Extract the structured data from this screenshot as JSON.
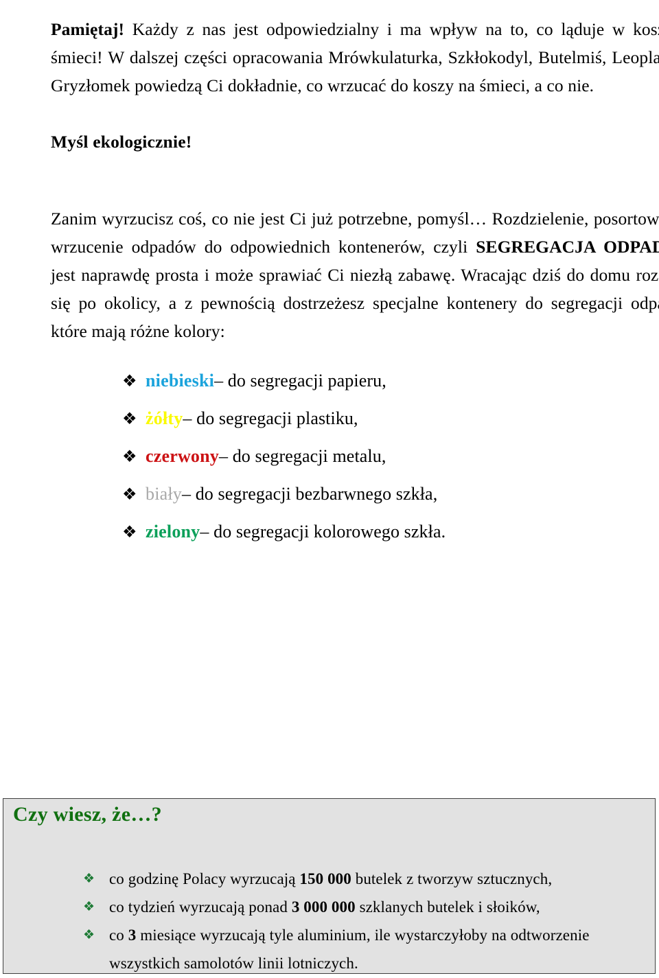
{
  "document": {
    "intro": {
      "bold_lead": "Pamiętaj!",
      "text": " Każdy z nas jest odpowiedzialny i ma wpływ na to, co ląduje w koszu na śmieci! W dalszej części opracowania Mrówkulaturka, Szkłokodyl, Butelmiś, Leoplastuś i Gryzłomek powiedzą Ci dokładnie, co wrzucać do koszy na śmieci, a co nie."
    },
    "subheading": "Myśl ekologicznie!",
    "body": {
      "part1": "Zanim wyrzucisz coś, co nie jest Ci już potrzebne, pomyśl… Rozdzielenie, posortowanie i wrzucenie odpadów do odpowiednich kontenerów, czyli ",
      "emphasis": "SEGREGACJA ODPADÓW,",
      "part2": " jest naprawdę prosta i może sprawiać Ci niezłą zabawę. Wracając dziś do domu rozejrzyj się po okolicy, a z pewnością dostrzeżesz specjalne kontenery do segregacji odpadów, które mają różne kolory:"
    },
    "bullet_glyph": "❖",
    "color_list": [
      {
        "keyword": "niebieski",
        "color": "#1BA3DC",
        "bold": true,
        "rest": " – do segregacji papieru,"
      },
      {
        "keyword": "żółty",
        "color": "#FAFA00",
        "bold": true,
        "rest": " – do segregacji plastiku,"
      },
      {
        "keyword": "czerwony",
        "color": "#CC1214",
        "bold": true,
        "rest": " – do segregacji metalu,"
      },
      {
        "keyword": "biały",
        "color": "#A8A8A8",
        "bold": false,
        "rest": " – do segregacji bezbarwnego szkła,"
      },
      {
        "keyword": "zielony",
        "color": "#0CA05A",
        "bold": true,
        "rest": " – do segregacji kolorowego szkła."
      }
    ],
    "fact_box": {
      "title": "Czy wiesz, że…?",
      "title_color": "#107010",
      "bullet_glyph": "❖",
      "bullet_color": "#1d7a35",
      "background": "#e2e2e2",
      "border_color": "#3f3f3f",
      "items": [
        {
          "pre": "co godzinę Polacy wyrzucają ",
          "num": "150 000",
          "post": " butelek z tworzyw sztucznych,",
          "cont": ""
        },
        {
          "pre": "co tydzień wyrzucają ponad ",
          "num": "3 000 000",
          "post": " szklanych butelek i słoików,",
          "cont": ""
        },
        {
          "pre": "co ",
          "num": "3",
          "post": " miesiące wyrzucają tyle aluminium, ile wystarczyłoby na odtworzenie",
          "cont": "wszystkich samolotów linii lotniczych."
        }
      ]
    }
  }
}
